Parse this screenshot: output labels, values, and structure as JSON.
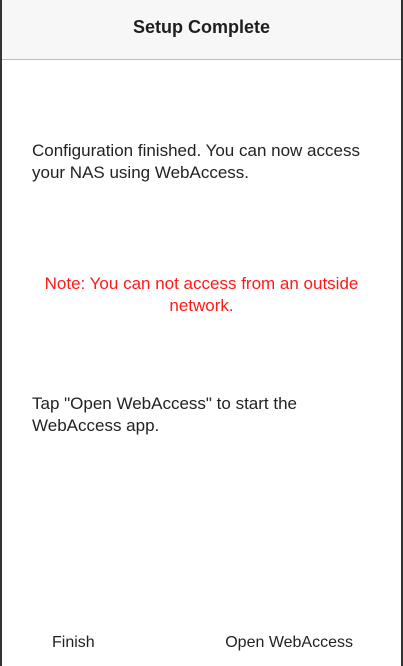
{
  "navbar": {
    "title": "Setup Complete"
  },
  "messages": {
    "configuration": "Configuration finished. You can now access your NAS using WebAccess.",
    "note": "Note: You can not access from an outside network.",
    "instruction": "Tap \"Open WebAccess\" to start the WebAccess app."
  },
  "buttons": {
    "finish_label": "Finish",
    "open_webaccess_label": "Open WebAccess"
  },
  "colors": {
    "note_text": "#ff1a1a",
    "navbar_background": "#f7f7f7"
  }
}
